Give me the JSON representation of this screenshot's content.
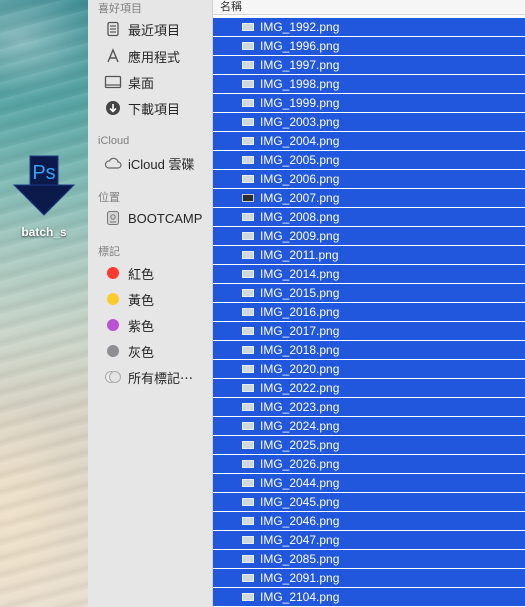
{
  "desktop": {
    "icon_label": "batch_s",
    "icon_text": "Ps"
  },
  "sidebar": {
    "favorites_title": "喜好項目",
    "favorites": [
      {
        "label": "最近項目",
        "icon": "recents-icon"
      },
      {
        "label": "應用程式",
        "icon": "applications-icon"
      },
      {
        "label": "桌面",
        "icon": "desktop-icon"
      },
      {
        "label": "下載項目",
        "icon": "downloads-icon"
      }
    ],
    "icloud_title": "iCloud",
    "icloud_drive": "iCloud 雲碟",
    "locations_title": "位置",
    "bootcamp": "BOOTCAMP",
    "tags_title": "標記",
    "tags": [
      {
        "label": "紅色",
        "color": "#fe3b30"
      },
      {
        "label": "黃色",
        "color": "#fecb2e"
      },
      {
        "label": "紫色",
        "color": "#b953d3"
      },
      {
        "label": "灰色",
        "color": "#8e8e93"
      }
    ],
    "all_tags": "所有標記⋯"
  },
  "filelist": {
    "column_name": "名稱",
    "selection_color": "#2157dc",
    "files": [
      "IMG_1992.png",
      "IMG_1996.png",
      "IMG_1997.png",
      "IMG_1998.png",
      "IMG_1999.png",
      "IMG_2003.png",
      "IMG_2004.png",
      "IMG_2005.png",
      "IMG_2006.png",
      "IMG_2007.png",
      "IMG_2008.png",
      "IMG_2009.png",
      "IMG_2011.png",
      "IMG_2014.png",
      "IMG_2015.png",
      "IMG_2016.png",
      "IMG_2017.png",
      "IMG_2018.png",
      "IMG_2020.png",
      "IMG_2022.png",
      "IMG_2023.png",
      "IMG_2024.png",
      "IMG_2025.png",
      "IMG_2026.png",
      "IMG_2044.png",
      "IMG_2045.png",
      "IMG_2046.png",
      "IMG_2047.png",
      "IMG_2085.png",
      "IMG_2091.png",
      "IMG_2104.png"
    ]
  }
}
